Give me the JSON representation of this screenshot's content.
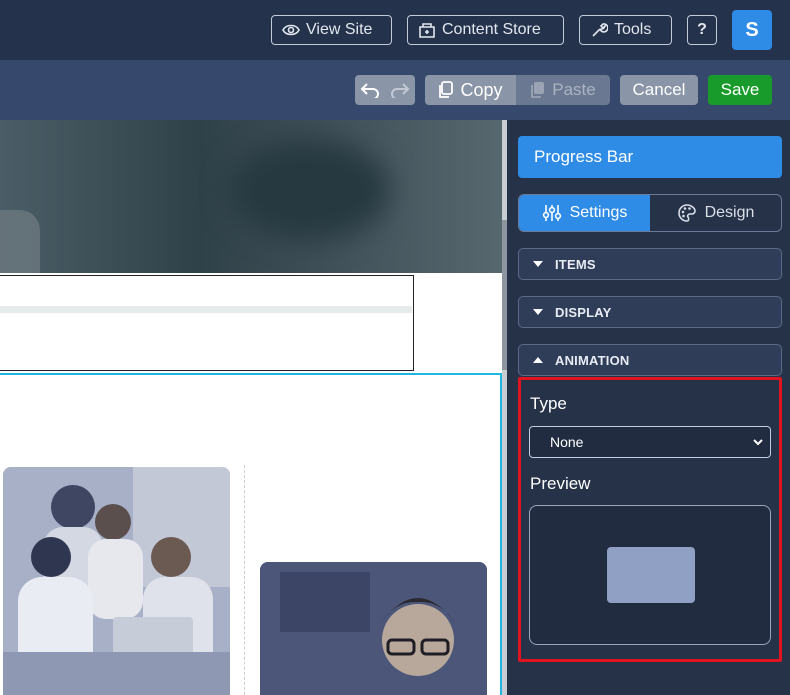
{
  "topbar": {
    "view_site": "View Site",
    "content_store": "Content Store",
    "tools": "Tools",
    "help": "?",
    "avatar_initial": "S",
    "avatar_color": "#2e8be6"
  },
  "toolbar": {
    "copy": "Copy",
    "paste": "Paste",
    "cancel": "Cancel",
    "save": "Save",
    "save_color": "#189b2a"
  },
  "panel": {
    "title": "Progress Bar",
    "tabs": [
      {
        "label": "Settings",
        "icon": "sliders-icon",
        "active": true
      },
      {
        "label": "Design",
        "icon": "palette-icon",
        "active": false
      }
    ],
    "sections": [
      {
        "label": "ITEMS",
        "expanded": false
      },
      {
        "label": "DISPLAY",
        "expanded": false
      },
      {
        "label": "ANIMATION",
        "expanded": true
      }
    ],
    "animation": {
      "type_label": "Type",
      "type_value": "None",
      "preview_label": "Preview"
    }
  },
  "accent_color": "#2e8be6",
  "highlight_color": "#e0141f"
}
